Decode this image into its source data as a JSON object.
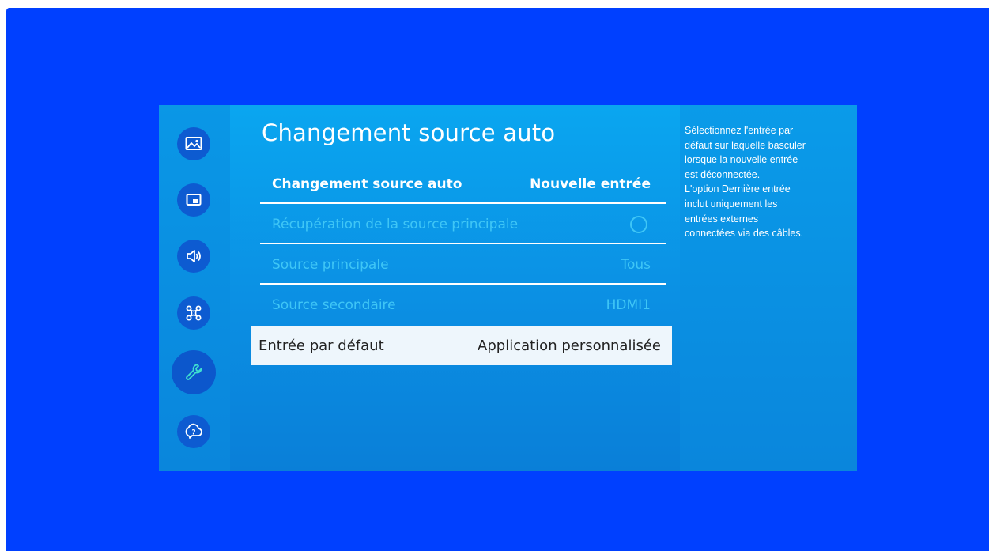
{
  "colors": {
    "background": "#0040ff",
    "panel": "#0aa6f0",
    "icon_circle": "#0d5bd1",
    "active_icon": "#3fe0d0",
    "disabled_text": "#3fc6f6",
    "selected_row_bg": "#eef6fc"
  },
  "sidebar": {
    "icons": [
      {
        "name": "picture-icon",
        "active": false
      },
      {
        "name": "picture-in-picture-icon",
        "active": false
      },
      {
        "name": "sound-icon",
        "active": false
      },
      {
        "name": "network-icon",
        "active": false
      },
      {
        "name": "wrench-icon",
        "active": true
      },
      {
        "name": "support-icon",
        "active": false
      }
    ]
  },
  "main": {
    "title": "Changement source auto",
    "rows": [
      {
        "label": "Changement source auto",
        "value": "Nouvelle entrée",
        "state": "enabled"
      },
      {
        "label": "Récupération de la source principale",
        "value": "",
        "control": "toggle-off",
        "state": "disabled"
      },
      {
        "label": "Source principale",
        "value": "Tous",
        "state": "disabled"
      },
      {
        "label": "Source secondaire",
        "value": "HDMI1",
        "state": "disabled"
      },
      {
        "label": "Entrée par défaut",
        "value": "Application personnalisée",
        "state": "selected"
      }
    ]
  },
  "help": {
    "text": "Sélectionnez l'entrée par\ndéfaut sur laquelle basculer\nlorsque la nouvelle entrée\nest déconnectée.\nL'option Dernière entrée\ninclut uniquement les\nentrées externes\nconnectées via des câbles."
  }
}
